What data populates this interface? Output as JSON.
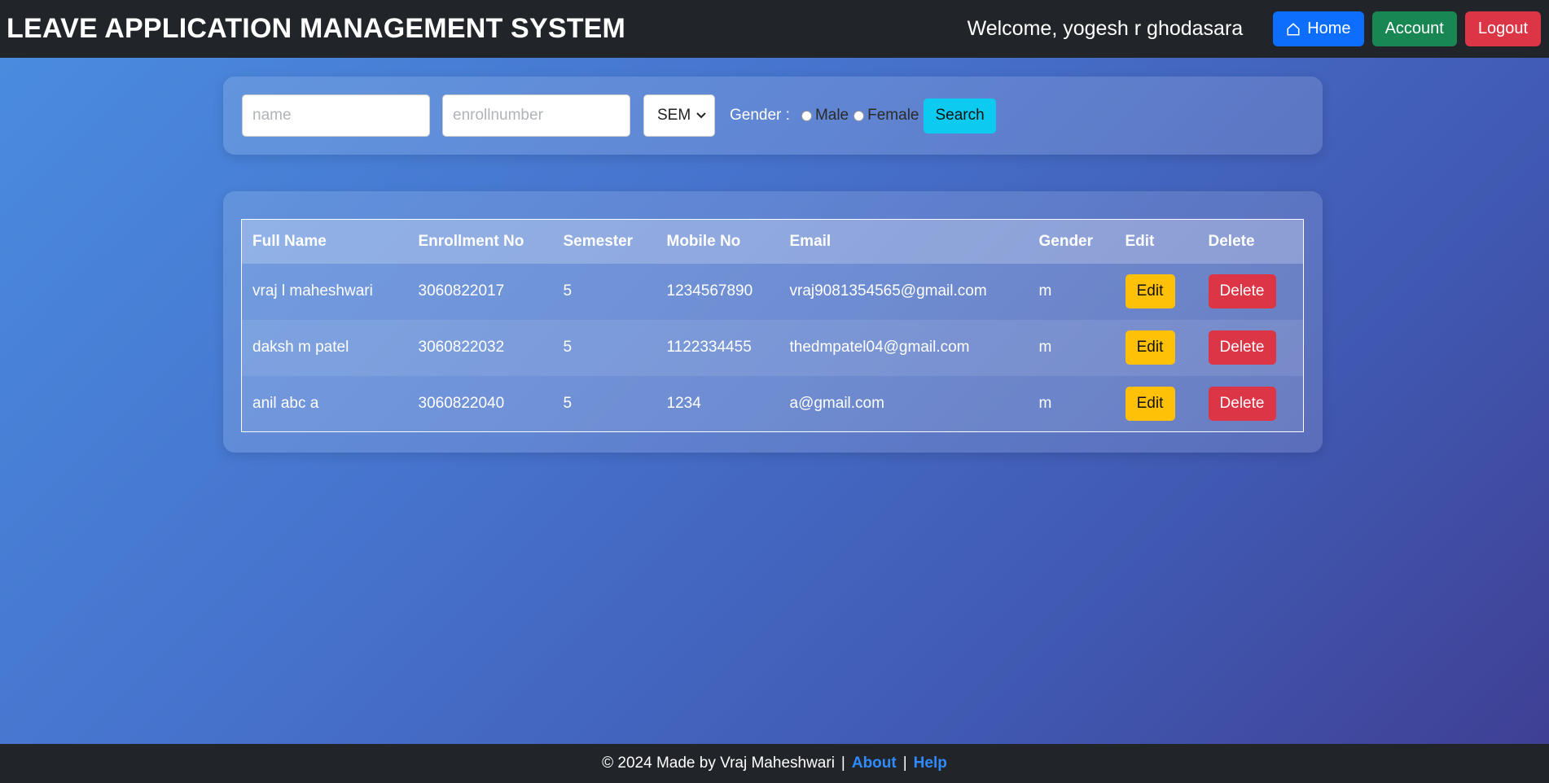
{
  "navbar": {
    "brand": "LEAVE APPLICATION MANAGEMENT SYSTEM",
    "welcome": "Welcome, yogesh r ghodasara",
    "home_label": "Home",
    "account_label": "Account",
    "logout_label": "Logout"
  },
  "search": {
    "name_placeholder": "name",
    "enroll_placeholder": "enrollnumber",
    "sem_selected": "SEM",
    "gender_label": "Gender :",
    "male_label": "Male",
    "female_label": "Female",
    "button_label": "Search"
  },
  "table": {
    "headers": [
      "Full Name",
      "Enrollment No",
      "Semester",
      "Mobile No",
      "Email",
      "Gender",
      "Edit",
      "Delete"
    ],
    "rows": [
      {
        "name": "vraj l maheshwari",
        "enroll": "3060822017",
        "sem": "5",
        "mobile": "1234567890",
        "email": "vraj9081354565@gmail.com",
        "gender": "m",
        "edit": "Edit",
        "delete": "Delete"
      },
      {
        "name": "daksh m patel",
        "enroll": "3060822032",
        "sem": "5",
        "mobile": "1122334455",
        "email": "thedmpatel04@gmail.com",
        "gender": "m",
        "edit": "Edit",
        "delete": "Delete"
      },
      {
        "name": "anil abc a",
        "enroll": "3060822040",
        "sem": "5",
        "mobile": "1234",
        "email": "a@gmail.com",
        "gender": "m",
        "edit": "Edit",
        "delete": "Delete"
      }
    ]
  },
  "footer": {
    "text": "© 2024 Made by Vraj Maheshwari",
    "sep": "|",
    "about": "About",
    "help": "Help"
  },
  "colors": {
    "navbar": "#212529",
    "home": "#0d6efd",
    "account": "#198754",
    "logout": "#dc3545",
    "search": "#0dcaf0",
    "edit": "#ffc107",
    "delete": "#dc3545"
  }
}
